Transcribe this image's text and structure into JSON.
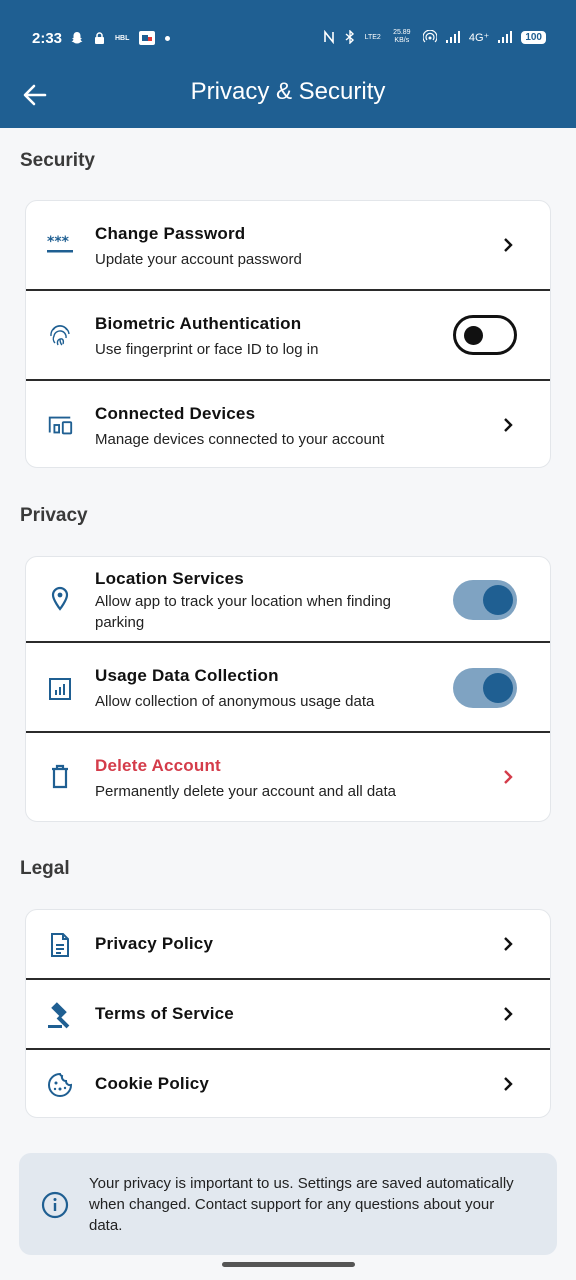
{
  "status_bar": {
    "time": "2:33",
    "carrier_badge": "HBL",
    "net_type": "4G⁺",
    "speed": "25.89 KB/s",
    "volte": "LTE2",
    "battery": "100"
  },
  "header": {
    "title": "Privacy & Security"
  },
  "sections": {
    "security": {
      "label": "Security",
      "items": [
        {
          "title": "Change Password",
          "subtitle": "Update your account password",
          "icon": "password-icon"
        },
        {
          "title": "Biometric Authentication",
          "subtitle": "Use fingerprint or face ID to log in",
          "icon": "fingerprint-icon",
          "toggle": "off"
        },
        {
          "title": "Connected Devices",
          "subtitle": "Manage devices connected to your account",
          "icon": "devices-icon"
        }
      ]
    },
    "privacy": {
      "label": "Privacy",
      "items": [
        {
          "title": "Location Services",
          "subtitle": "Allow app to track your location when finding parking",
          "icon": "location-pin-icon",
          "toggle": "on"
        },
        {
          "title": "Usage Data Collection",
          "subtitle": "Allow collection of anonymous usage data",
          "icon": "analytics-icon",
          "toggle": "on"
        },
        {
          "title": "Delete Account",
          "subtitle": "Permanently delete your account and all data",
          "icon": "trash-icon"
        }
      ]
    },
    "legal": {
      "label": "Legal",
      "items": [
        {
          "title": "Privacy Policy",
          "icon": "document-icon"
        },
        {
          "title": "Terms of Service",
          "icon": "gavel-icon"
        },
        {
          "title": "Cookie Policy",
          "icon": "cookie-icon"
        }
      ]
    }
  },
  "info_note": "Your privacy is important to us. Settings are saved automatically when changed. Contact support for any questions about your data.",
  "colors": {
    "primary": "#1f5f92",
    "danger": "#d43c4a",
    "toggle_track_on": "#7fa3c2"
  }
}
